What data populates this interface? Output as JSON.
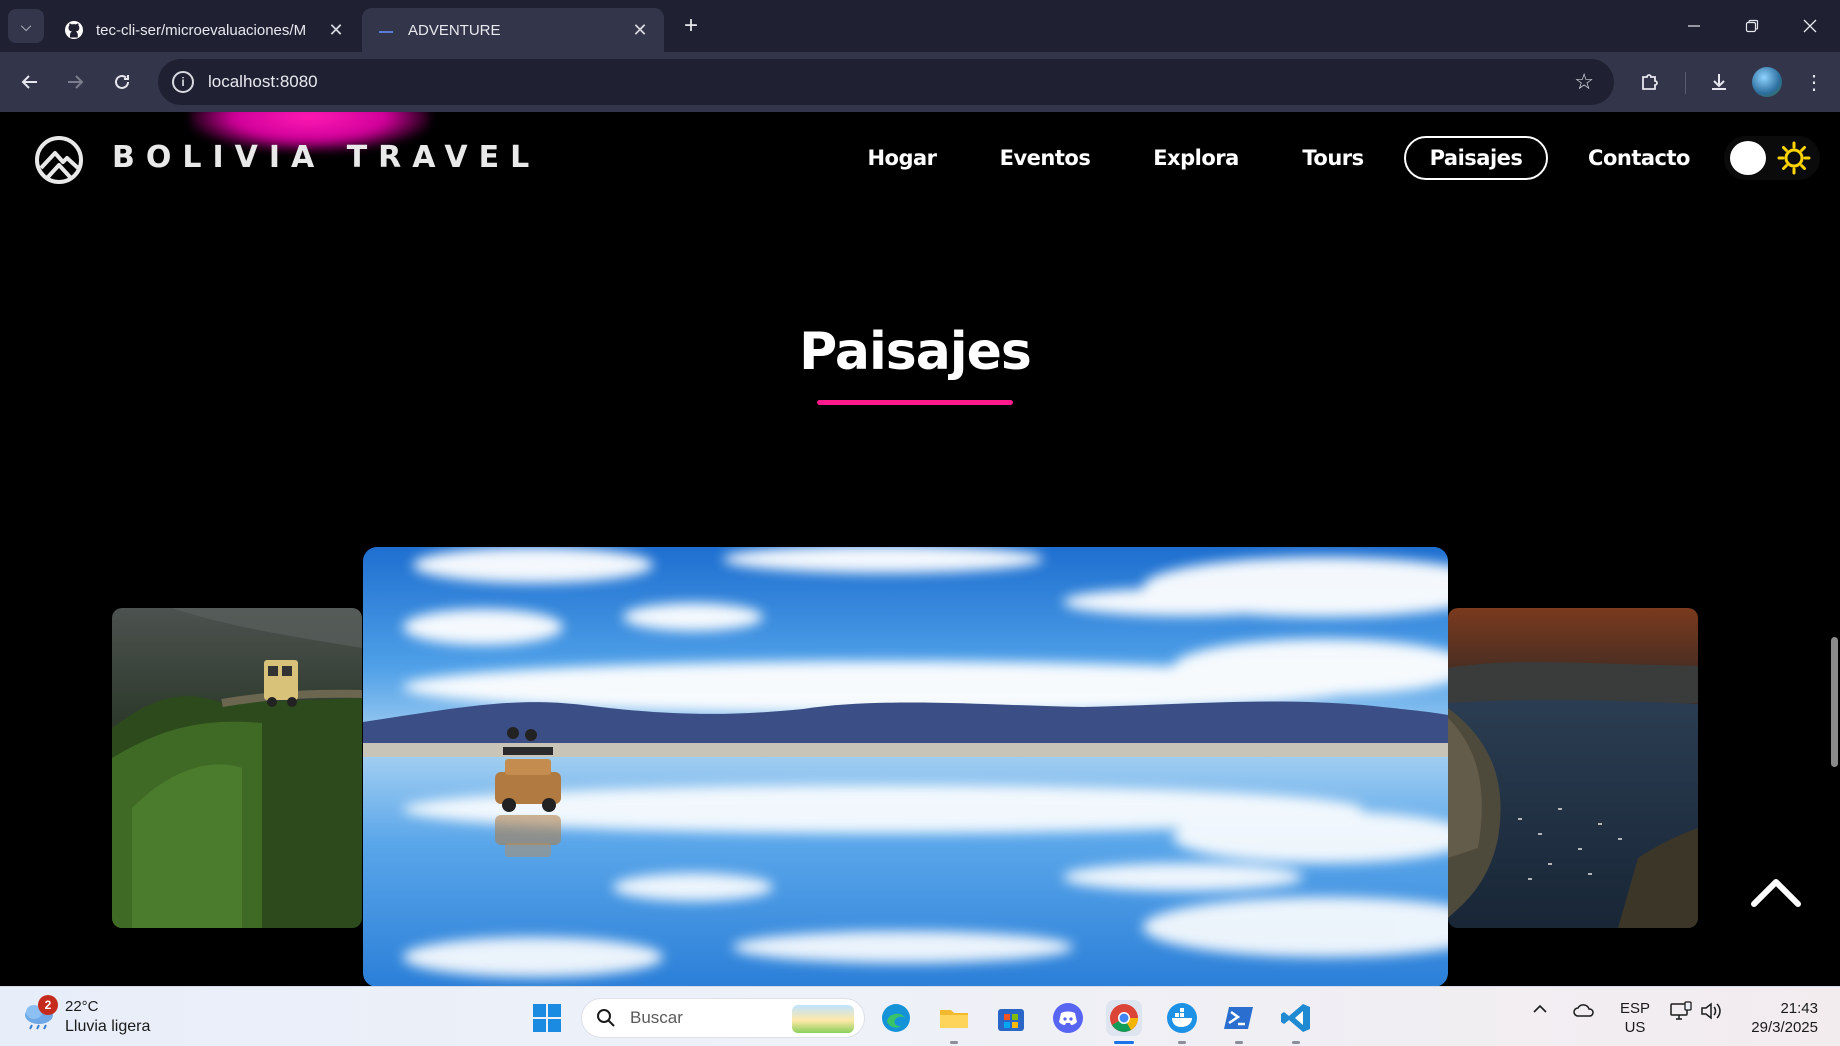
{
  "browser": {
    "tabs": [
      {
        "title": "tec-cli-ser/microevaluaciones/M",
        "icon": "github-icon",
        "active": false
      },
      {
        "title": "ADVENTURE",
        "icon": "page-favicon",
        "active": true
      }
    ],
    "address": "localhost:8080"
  },
  "site": {
    "brand": "BOLIVIA TRAVEL",
    "nav": [
      {
        "label": "Hogar",
        "active": false
      },
      {
        "label": "Eventos",
        "active": false
      },
      {
        "label": "Explora",
        "active": false
      },
      {
        "label": "Tours",
        "active": false
      },
      {
        "label": "Paisajes",
        "active": true
      },
      {
        "label": "Contacto",
        "active": false
      }
    ],
    "section_title": "Paisajes",
    "accent": "#ff1a8c",
    "carousel": [
      "yungas-road-image",
      "salar-de-uyuni-image",
      "lake-titicaca-image"
    ]
  },
  "taskbar": {
    "weather_temp": "22°C",
    "weather_desc": "Lluvia ligera",
    "weather_badge": "2",
    "search_placeholder": "Buscar",
    "lang_top": "ESP",
    "lang_bottom": "US",
    "time": "21:43",
    "date": "29/3/2025"
  }
}
